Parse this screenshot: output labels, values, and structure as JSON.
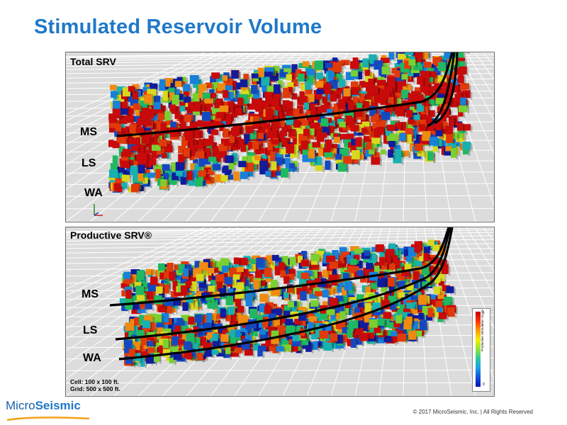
{
  "title": "Stimulated Reservoir Volume",
  "panels": [
    {
      "label": "Total SRV",
      "formations": [
        "MS",
        "LS",
        "WA"
      ]
    },
    {
      "label": "Productive SRV®",
      "formations": [
        "MS",
        "LS",
        "WA"
      ],
      "notes": [
        "Cell: 100 x 100 ft.",
        "Grid: 500 x 500 ft."
      ],
      "colorbar": {
        "title": "Productive Stimulation Score",
        "max_label": "1",
        "min_label": "0",
        "colors": [
          "#c80000",
          "#ff3000",
          "#ff9a00",
          "#f4f000",
          "#8ee63a",
          "#2ec8a0",
          "#18a0e8",
          "#1050d8",
          "#0a10b0"
        ]
      }
    }
  ],
  "footer": {
    "logo_prefix": "Micro",
    "logo_suffix": "Seismic",
    "copyright": "© 2017 MicroSeismic, Inc. | All Rights Reserved"
  },
  "palette": [
    "#c80a0a",
    "#e03a0a",
    "#f08a10",
    "#d8d820",
    "#7ad030",
    "#20b860",
    "#18b0b0",
    "#1880d8",
    "#1448c0",
    "#101c9c"
  ]
}
